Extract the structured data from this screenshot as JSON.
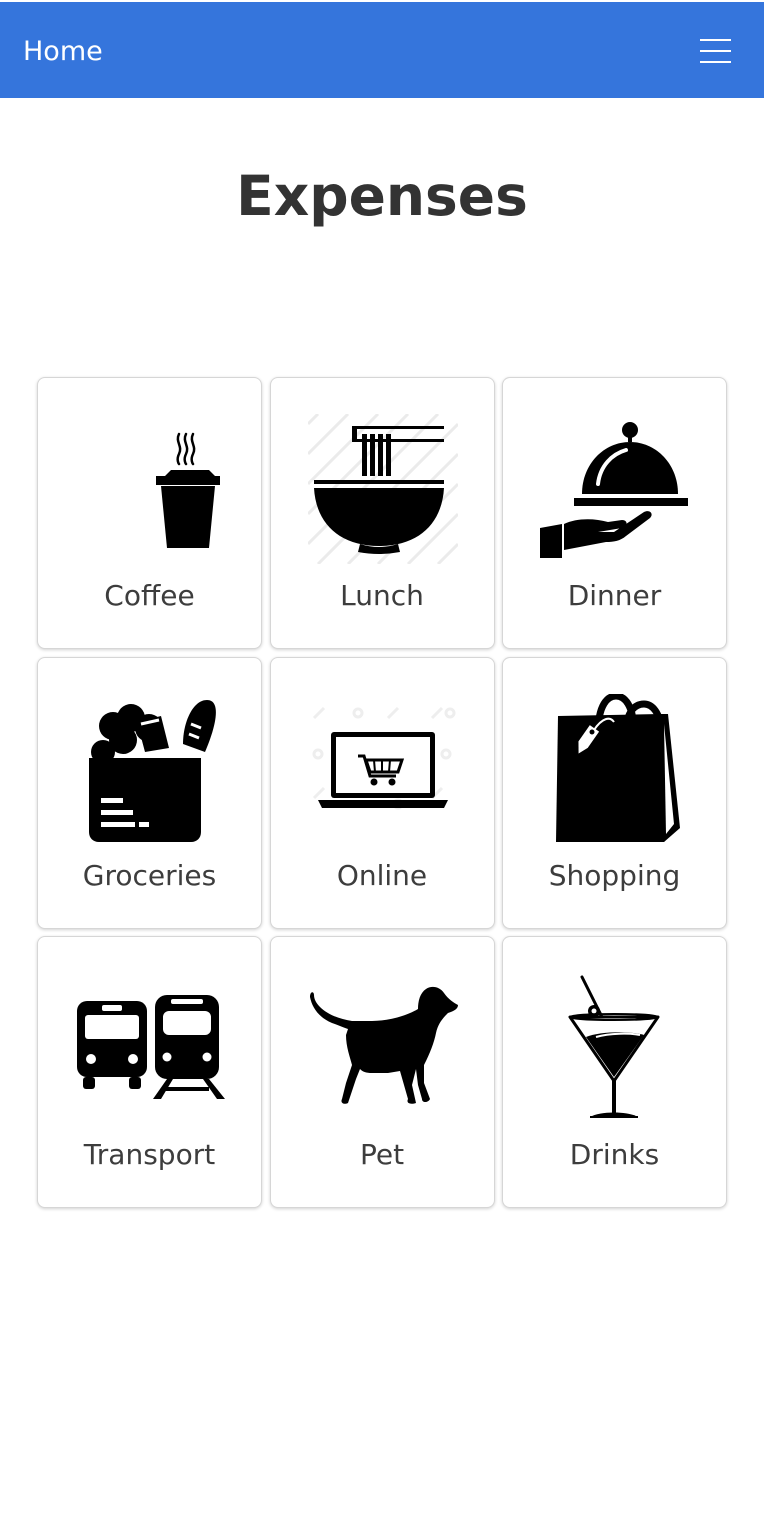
{
  "navbar": {
    "brand": "Home",
    "background": "#3575dc",
    "menu_icon": "hamburger-menu-icon"
  },
  "page": {
    "title": "Expenses"
  },
  "categories": [
    {
      "label": "Coffee",
      "icon": "coffee-cup-icon"
    },
    {
      "label": "Lunch",
      "icon": "noodle-bowl-icon"
    },
    {
      "label": "Dinner",
      "icon": "serving-cloche-icon"
    },
    {
      "label": "Groceries",
      "icon": "grocery-bag-icon"
    },
    {
      "label": "Online",
      "icon": "laptop-cart-icon"
    },
    {
      "label": "Shopping",
      "icon": "shopping-bag-icon"
    },
    {
      "label": "Transport",
      "icon": "bus-train-icon"
    },
    {
      "label": "Pet",
      "icon": "dog-icon"
    },
    {
      "label": "Drinks",
      "icon": "cocktail-icon"
    }
  ]
}
